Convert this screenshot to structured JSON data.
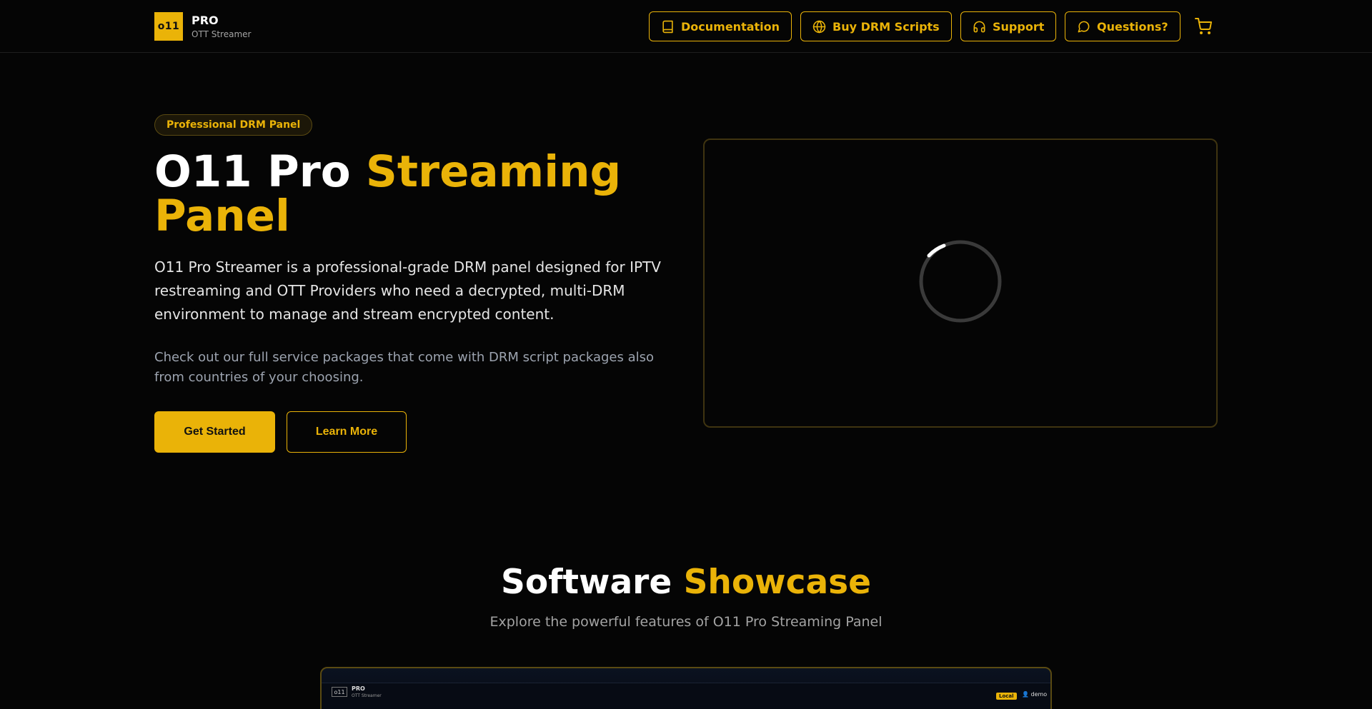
{
  "brand": {
    "logo_text": "o11",
    "title": "PRO",
    "subtitle": "OTT Streamer"
  },
  "nav": {
    "items": [
      {
        "label": "Documentation",
        "icon": "book-icon"
      },
      {
        "label": "Buy DRM Scripts",
        "icon": "globe-icon"
      },
      {
        "label": "Support",
        "icon": "headphones-icon"
      },
      {
        "label": "Questions?",
        "icon": "message-circle-icon"
      }
    ],
    "cart_icon": "shopping-cart-icon"
  },
  "hero": {
    "badge": "Professional DRM Panel",
    "title_plain": "O11 Pro ",
    "title_accent": "Streaming Panel",
    "description": "O11 Pro Streamer is a professional-grade DRM panel designed for IPTV restreaming and OTT Providers who need a decrypted, multi-DRM environment to manage and stream encrypted content.",
    "note": "Check out our full service packages that come with DRM script packages also from countries of your choosing.",
    "primary_button": "Get Started",
    "secondary_button": "Learn More"
  },
  "video": {
    "state": "loading"
  },
  "showcase": {
    "title_plain": "Software ",
    "title_accent": "Showcase",
    "subtitle": "Explore the powerful features of O11 Pro Streaming Panel",
    "preview": {
      "logo_text": "o11",
      "title": "PRO",
      "subtitle": "OTT Streamer",
      "badge": "Local",
      "user": "demo"
    }
  },
  "colors": {
    "accent": "#eab308",
    "background": "#050505",
    "text": "#ffffff",
    "muted": "#9ca3af"
  }
}
